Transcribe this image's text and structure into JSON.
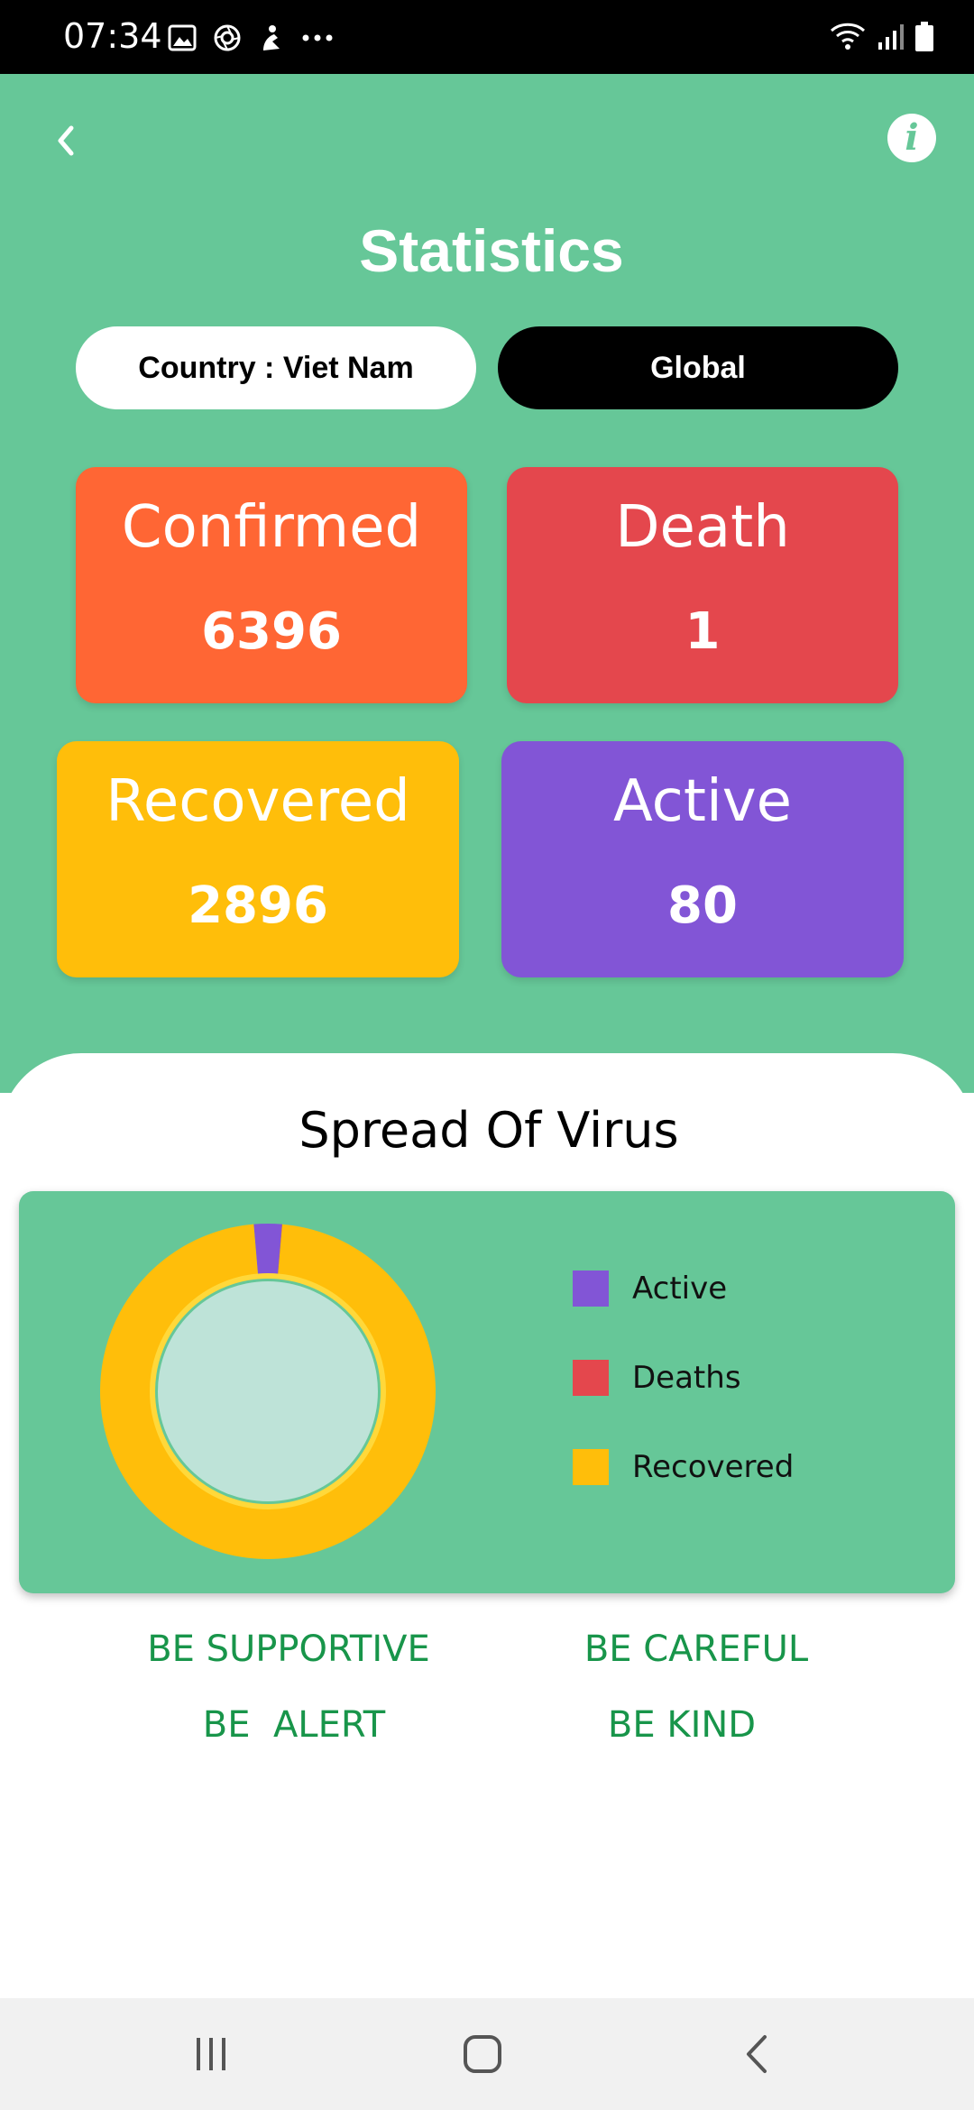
{
  "status_bar": {
    "time": "07:34",
    "left_icons": [
      "gallery-icon",
      "camera-lens-icon",
      "app-notification-icon",
      "more-dots-icon"
    ],
    "right_icons": [
      "wifi-icon",
      "signal-icon",
      "battery-icon"
    ]
  },
  "header": {
    "title": "Statistics",
    "back_icon": "chevron-left-icon",
    "info_icon": "info-icon",
    "info_glyph": "i"
  },
  "toggles": {
    "country_label": "Country : Viet Nam",
    "global_label": "Global"
  },
  "stats": {
    "confirmed": {
      "label": "Confirmed",
      "value": "6396",
      "color": "#FF6634"
    },
    "death": {
      "label": "Death",
      "value": "1",
      "color": "#E4474D"
    },
    "recovered": {
      "label": "Recovered",
      "value": "2896",
      "color": "#FFBE0A"
    },
    "active": {
      "label": "Active",
      "value": "80",
      "color": "#8255D6"
    }
  },
  "chart": {
    "title": "Spread Of Virus",
    "legend": [
      {
        "label": "Active",
        "color": "#8255D6"
      },
      {
        "label": "Deaths",
        "color": "#E4474D"
      },
      {
        "label": "Recovered",
        "color": "#FFBE0A"
      }
    ]
  },
  "chart_data": {
    "type": "pie",
    "categories": [
      "Active",
      "Deaths",
      "Recovered"
    ],
    "values": [
      80,
      1,
      2896
    ],
    "colors": [
      "#8255D6",
      "#E4474D",
      "#FFBE0A"
    ],
    "title": "Spread Of Virus",
    "legend": "right"
  },
  "slogans": {
    "s1": "BE SUPPORTIVE",
    "s2": "BE CAREFUL",
    "s3": "BE  ALERT",
    "s4": "BE KIND"
  },
  "nav_bar": {
    "icons": [
      "recent-apps-icon",
      "home-icon",
      "back-icon"
    ]
  },
  "colors": {
    "background_green": "#66C798",
    "slogan_green": "#18954a",
    "donut_center": "#BEE3D8"
  }
}
